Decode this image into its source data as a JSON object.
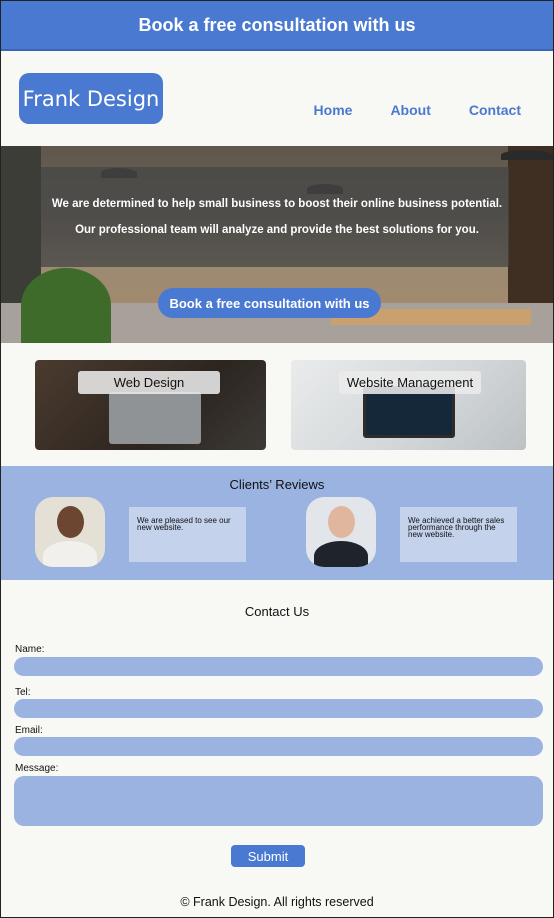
{
  "banner": {
    "text": "Book a free consultation with us"
  },
  "header": {
    "logo": "Frank Design",
    "nav": [
      "Home",
      "About",
      "Contact"
    ]
  },
  "hero": {
    "line1": "We are determined to help small business to  boost their online business potential.",
    "line2": "Our professional team will analyze and provide the best solutions for you.",
    "cta": "Book a free consultation with us"
  },
  "services": [
    {
      "label": "Web Design"
    },
    {
      "label": "Website Management"
    }
  ],
  "reviews": {
    "title": "Clients’ Reviews",
    "items": [
      {
        "quote": "We are pleased to see our new website."
      },
      {
        "quote": "We achieved a better sales performance through the new website."
      }
    ]
  },
  "contact": {
    "title": "Contact Us",
    "fields": {
      "name": "Name:",
      "tel": "Tel:",
      "email": "Email:",
      "message": "Message:"
    },
    "submit": "Submit"
  },
  "footer": {
    "text": "© Frank Design. All rights reserved"
  },
  "colors": {
    "accent": "#4a79d1",
    "light_accent": "#9ab3e0",
    "background": "#f8f9f4"
  }
}
